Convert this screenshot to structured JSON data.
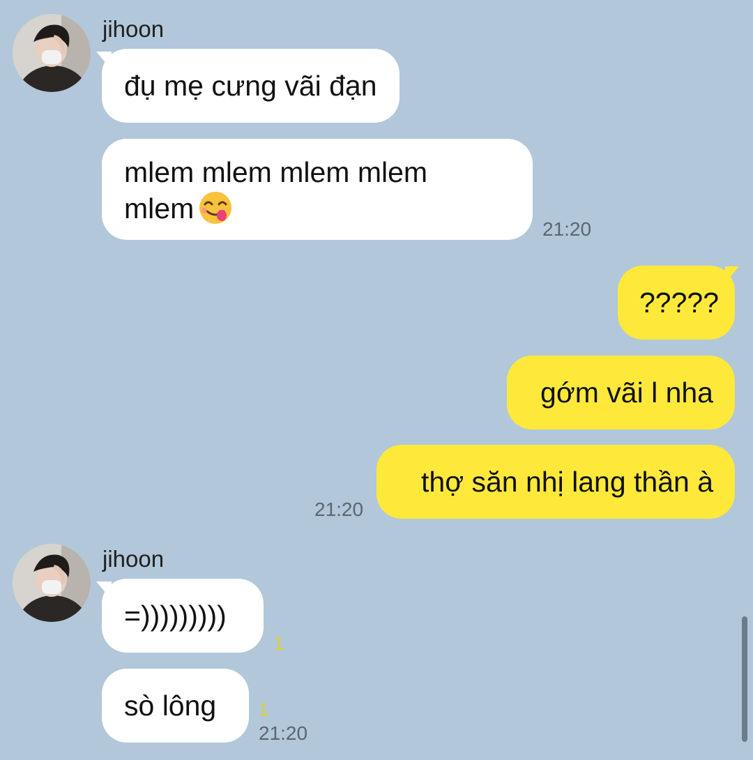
{
  "colors": {
    "background": "#b2c7da",
    "incoming_bubble": "#ffffff",
    "outgoing_bubble": "#fee93b",
    "unread_count": "#e0cf2b",
    "timestamp": "#5b6670"
  },
  "groups": [
    {
      "side": "incoming",
      "sender": "jihoon",
      "avatar_icon": "profile-photo",
      "messages": [
        {
          "text": "đụ mẹ cưng vãi đạn"
        },
        {
          "line1": "mlem mlem mlem mlem",
          "line2": "mlem",
          "emoji_icon": "face-savoring-food-emoji"
        }
      ],
      "time": "21:20"
    },
    {
      "side": "outgoing",
      "messages": [
        {
          "text": "?????"
        },
        {
          "text": "gớm vãi l nha"
        },
        {
          "text": "thợ săn nhị lang thần à"
        }
      ],
      "time": "21:20"
    },
    {
      "side": "incoming",
      "sender": "jihoon",
      "avatar_icon": "profile-photo",
      "messages": [
        {
          "text": "=)))))))))",
          "unread": "1"
        },
        {
          "text": "sò lông",
          "unread": "1"
        }
      ],
      "time": "21:20"
    }
  ]
}
